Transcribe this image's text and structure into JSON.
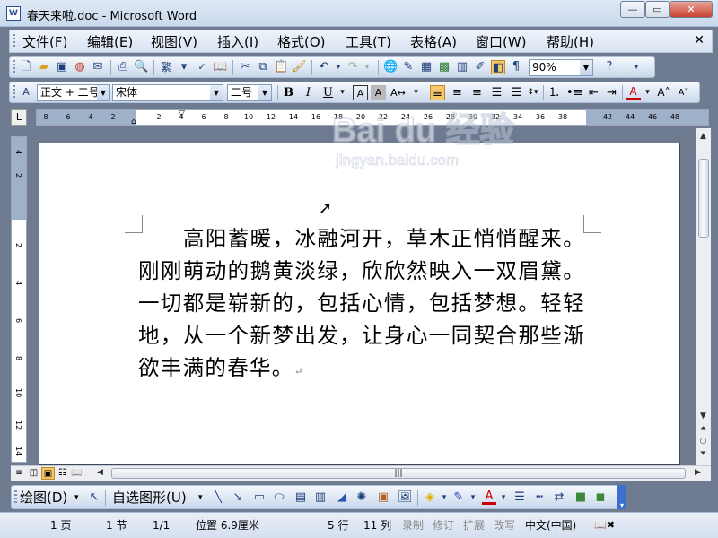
{
  "window": {
    "title": "春天来啦.doc - Microsoft Word",
    "app_icon": "W"
  },
  "menubar": {
    "items": [
      "文件(F)",
      "编辑(E)",
      "视图(V)",
      "插入(I)",
      "格式(O)",
      "工具(T)",
      "表格(A)",
      "窗口(W)",
      "帮助(H)"
    ],
    "close_glyph": "✕"
  },
  "toolbar_standard": {
    "zoom": "90%"
  },
  "toolbar_format": {
    "style": "正文 + 二号",
    "font": "宋体",
    "size": "二号"
  },
  "ruler": {
    "numbers": [
      "8",
      "6",
      "4",
      "2",
      "2",
      "4",
      "6",
      "8",
      "10",
      "12",
      "14",
      "16",
      "18",
      "20",
      "22",
      "24",
      "26",
      "28",
      "30",
      "32",
      "34",
      "36",
      "38",
      "42",
      "44",
      "46",
      "48"
    ],
    "vertical_numbers": [
      "4",
      "2",
      "2",
      "4",
      "6",
      "8",
      "10",
      "12",
      "14"
    ]
  },
  "document": {
    "body_text": "高阳蓄暖，冰融河开，草木正悄悄醒来。刚刚萌动的鹅黄淡绿，欣欣然映入一双眉黛。一切都是崭新的，包括心情，包括梦想。轻轻地，从一个新梦出发，让身心一同契合那些渐欲丰满的春华。",
    "paragraph_mark": "↵"
  },
  "drawbar": {
    "draw_label": "绘图(D)",
    "autoshape_label": "自选图形(U)",
    "text_color_glyph": "A"
  },
  "statusbar": {
    "page": "1 页",
    "section": "1 节",
    "page_of": "1/1",
    "position": "位置 6.9厘米",
    "line": "5 行",
    "column": "11 列",
    "rec": "录制",
    "trk": "修订",
    "ext": "扩展",
    "ovr": "改写",
    "language": "中文(中国)"
  },
  "watermark": {
    "brand": "Bai du 经验",
    "url": "jingyan.baidu.com"
  }
}
